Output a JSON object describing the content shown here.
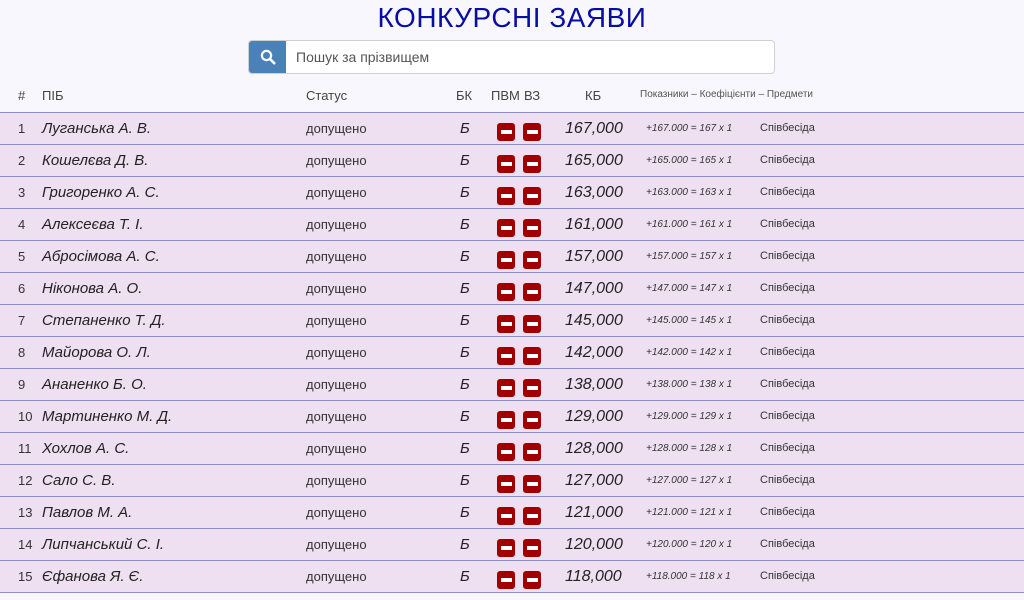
{
  "page": {
    "title": "КОНКУРСНІ ЗАЯВИ"
  },
  "search": {
    "icon": "search-icon",
    "placeholder": "Пошук за прізвищем",
    "value": ""
  },
  "table": {
    "columns": {
      "num": "#",
      "name": "ПІБ",
      "status": "Статус",
      "bk": "БК",
      "pvm": "ПВМ",
      "vz": "ВЗ",
      "kb": "КБ",
      "details": "Показники – Коефіцієнти – Предмети"
    },
    "rows": [
      {
        "num": "1",
        "name": "Луганська А. В.",
        "status": "допущено",
        "bk": "Б",
        "kb": "167,000",
        "formula": "+167.000 = 167 х 1",
        "subject": "Співбесіда"
      },
      {
        "num": "2",
        "name": "Кошелєва Д. В.",
        "status": "допущено",
        "bk": "Б",
        "kb": "165,000",
        "formula": "+165.000 = 165 х 1",
        "subject": "Співбесіда"
      },
      {
        "num": "3",
        "name": "Григоренко А. С.",
        "status": "допущено",
        "bk": "Б",
        "kb": "163,000",
        "formula": "+163.000 = 163 х 1",
        "subject": "Співбесіда"
      },
      {
        "num": "4",
        "name": "Алексеєва Т. І.",
        "status": "допущено",
        "bk": "Б",
        "kb": "161,000",
        "formula": "+161.000 = 161 х 1",
        "subject": "Співбесіда"
      },
      {
        "num": "5",
        "name": "Абросімова А. С.",
        "status": "допущено",
        "bk": "Б",
        "kb": "157,000",
        "formula": "+157.000 = 157 х 1",
        "subject": "Співбесіда"
      },
      {
        "num": "6",
        "name": "Ніконова А. О.",
        "status": "допущено",
        "bk": "Б",
        "kb": "147,000",
        "formula": "+147.000 = 147 х 1",
        "subject": "Співбесіда"
      },
      {
        "num": "7",
        "name": "Степаненко Т. Д.",
        "status": "допущено",
        "bk": "Б",
        "kb": "145,000",
        "formula": "+145.000 = 145 х 1",
        "subject": "Співбесіда"
      },
      {
        "num": "8",
        "name": "Майорова О. Л.",
        "status": "допущено",
        "bk": "Б",
        "kb": "142,000",
        "formula": "+142.000 = 142 х 1",
        "subject": "Співбесіда"
      },
      {
        "num": "9",
        "name": "Ананенко Б. О.",
        "status": "допущено",
        "bk": "Б",
        "kb": "138,000",
        "formula": "+138.000 = 138 х 1",
        "subject": "Співбесіда"
      },
      {
        "num": "10",
        "name": "Мартиненко М. Д.",
        "status": "допущено",
        "bk": "Б",
        "kb": "129,000",
        "formula": "+129.000 = 129 х 1",
        "subject": "Співбесіда"
      },
      {
        "num": "11",
        "name": "Хохлов А. С.",
        "status": "допущено",
        "bk": "Б",
        "kb": "128,000",
        "formula": "+128.000 = 128 х 1",
        "subject": "Співбесіда"
      },
      {
        "num": "12",
        "name": "Сало С. В.",
        "status": "допущено",
        "bk": "Б",
        "kb": "127,000",
        "formula": "+127.000 = 127 х 1",
        "subject": "Співбесіда"
      },
      {
        "num": "13",
        "name": "Павлов М. А.",
        "status": "допущено",
        "bk": "Б",
        "kb": "121,000",
        "formula": "+121.000 = 121 х 1",
        "subject": "Співбесіда"
      },
      {
        "num": "14",
        "name": "Липчанський С. І.",
        "status": "допущено",
        "bk": "Б",
        "kb": "120,000",
        "formula": "+120.000 = 120 х 1",
        "subject": "Співбесіда"
      },
      {
        "num": "15",
        "name": "Єфанова Я. Є.",
        "status": "допущено",
        "bk": "Б",
        "kb": "118,000",
        "formula": "+118.000 = 118 х 1",
        "subject": "Співбесіда"
      }
    ]
  },
  "colors": {
    "title": "#0a0ea0",
    "search_button": "#4a82b8",
    "row_background": "#efe0f1",
    "row_border": "#8d8dd0",
    "flag": "#a00000"
  }
}
